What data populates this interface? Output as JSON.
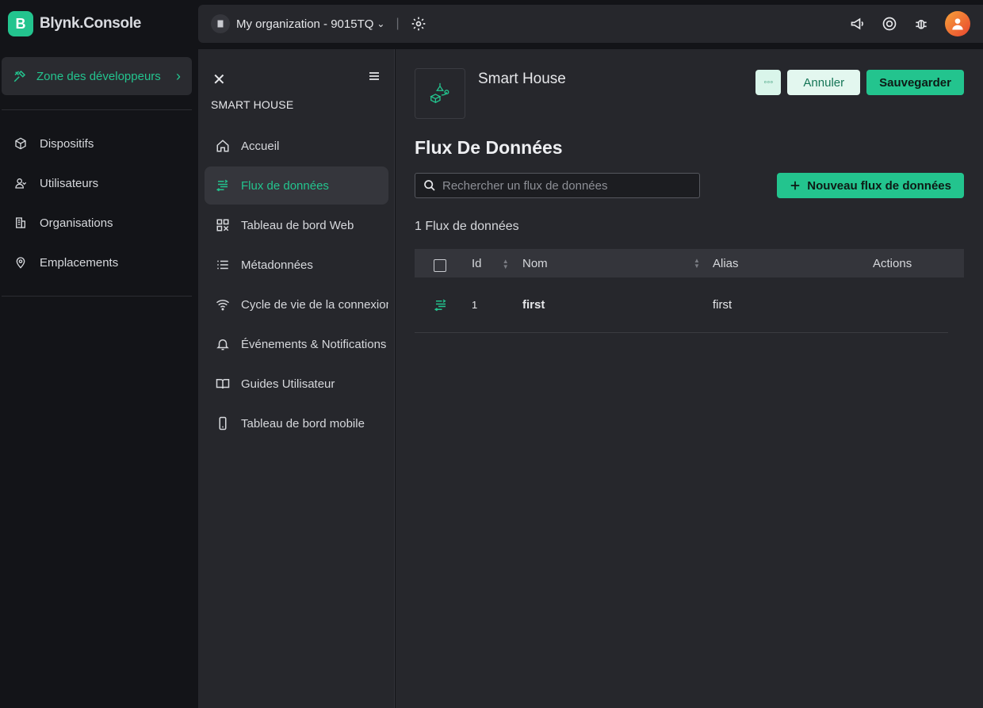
{
  "brand": {
    "logo_letter": "B",
    "name": "Blynk.Console"
  },
  "dev_zone": {
    "label": "Zone des développeurs"
  },
  "sidebar": {
    "items": [
      {
        "label": "Dispositifs",
        "icon": "cube-icon"
      },
      {
        "label": "Utilisateurs",
        "icon": "users-icon"
      },
      {
        "label": "Organisations",
        "icon": "building-icon"
      },
      {
        "label": "Emplacements",
        "icon": "location-pin-icon"
      }
    ]
  },
  "topbar": {
    "org_name": "My organization - 9015TQ"
  },
  "subnav": {
    "title": "SMART HOUSE",
    "items": [
      {
        "label": "Accueil",
        "icon": "home-icon",
        "active": false
      },
      {
        "label": "Flux de données",
        "icon": "datastream-icon",
        "active": true
      },
      {
        "label": "Tableau de bord Web",
        "icon": "dashboard-icon",
        "active": false
      },
      {
        "label": "Métadonnées",
        "icon": "list-icon",
        "active": false
      },
      {
        "label": "Cycle de vie de la connexion",
        "icon": "wifi-icon",
        "active": false
      },
      {
        "label": "Événements & Notifications",
        "icon": "bell-icon",
        "active": false
      },
      {
        "label": "Guides Utilisateur",
        "icon": "book-icon",
        "active": false
      },
      {
        "label": "Tableau de bord mobile",
        "icon": "mobile-icon",
        "active": false
      }
    ]
  },
  "main": {
    "template_name": "Smart House",
    "more_label": "◦◦◦",
    "cancel_label": "Annuler",
    "save_label": "Sauvegarder",
    "page_title": "Flux De Données",
    "search_placeholder": "Rechercher un flux de données",
    "new_button_label": "Nouveau flux de données",
    "count_label": "1 Flux de données",
    "table": {
      "headers": {
        "id": "Id",
        "name": "Nom",
        "alias": "Alias",
        "actions": "Actions"
      },
      "rows": [
        {
          "id": "1",
          "name": "first",
          "alias": "first"
        }
      ]
    }
  },
  "colors": {
    "accent": "#23c48e",
    "bg": "#131418",
    "panel": "#26272c"
  }
}
